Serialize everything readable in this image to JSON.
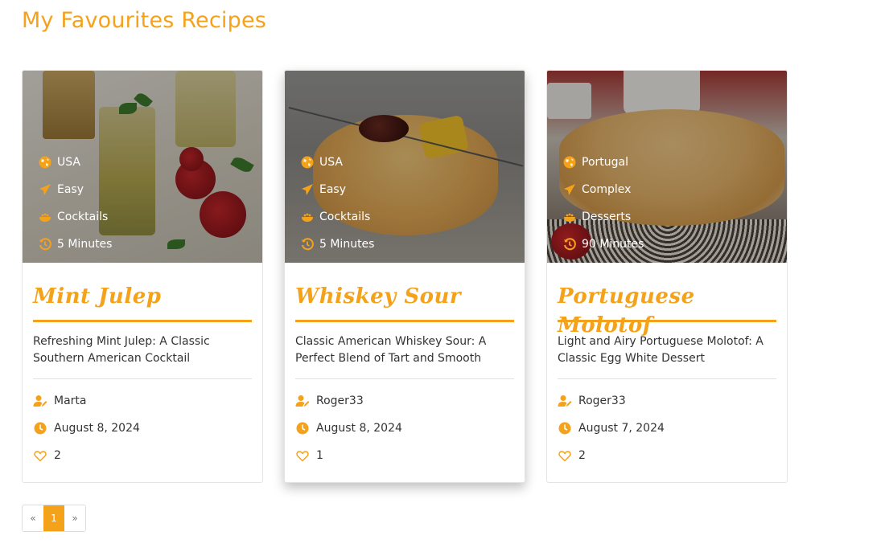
{
  "page": {
    "title": "My Favourites Recipes"
  },
  "colors": {
    "accent": "#f5a21b",
    "text": "#333333",
    "border": "#e4e4e4"
  },
  "recipes": [
    {
      "image": "mint-julep-photo",
      "country": "USA",
      "difficulty": "Easy",
      "category": "Cocktails",
      "time": "5 Minutes",
      "title": "Mint Julep",
      "description": "Refreshing Mint Julep: A Classic Southern American Cocktail",
      "author": "Marta",
      "date": "August 8, 2024",
      "likes": "2"
    },
    {
      "image": "whiskey-sour-photo",
      "country": "USA",
      "difficulty": "Easy",
      "category": "Cocktails",
      "time": "5 Minutes",
      "title": "Whiskey Sour",
      "description": "Classic American Whiskey Sour: A Perfect Blend of Tart and Smooth",
      "author": "Roger33",
      "date": "August 8, 2024",
      "likes": "1"
    },
    {
      "image": "portuguese-molotof-photo",
      "country": "Portugal",
      "difficulty": "Complex",
      "category": "Desserts",
      "time": "90 Minutes",
      "title": "Portuguese Molotof",
      "description": "Light and Airy Portuguese Molotof: A Classic Egg White Dessert",
      "author": "Roger33",
      "date": "August 7, 2024",
      "likes": "2"
    }
  ],
  "icons": {
    "country": "globe-icon",
    "difficulty": "paper-plane-icon",
    "category": "bowl-icon",
    "time": "clock-history-icon",
    "author": "user-edit-icon",
    "date": "clock-icon",
    "likes": "heart-icon"
  },
  "pagination": {
    "prev": "«",
    "current": "1",
    "next": "»"
  }
}
